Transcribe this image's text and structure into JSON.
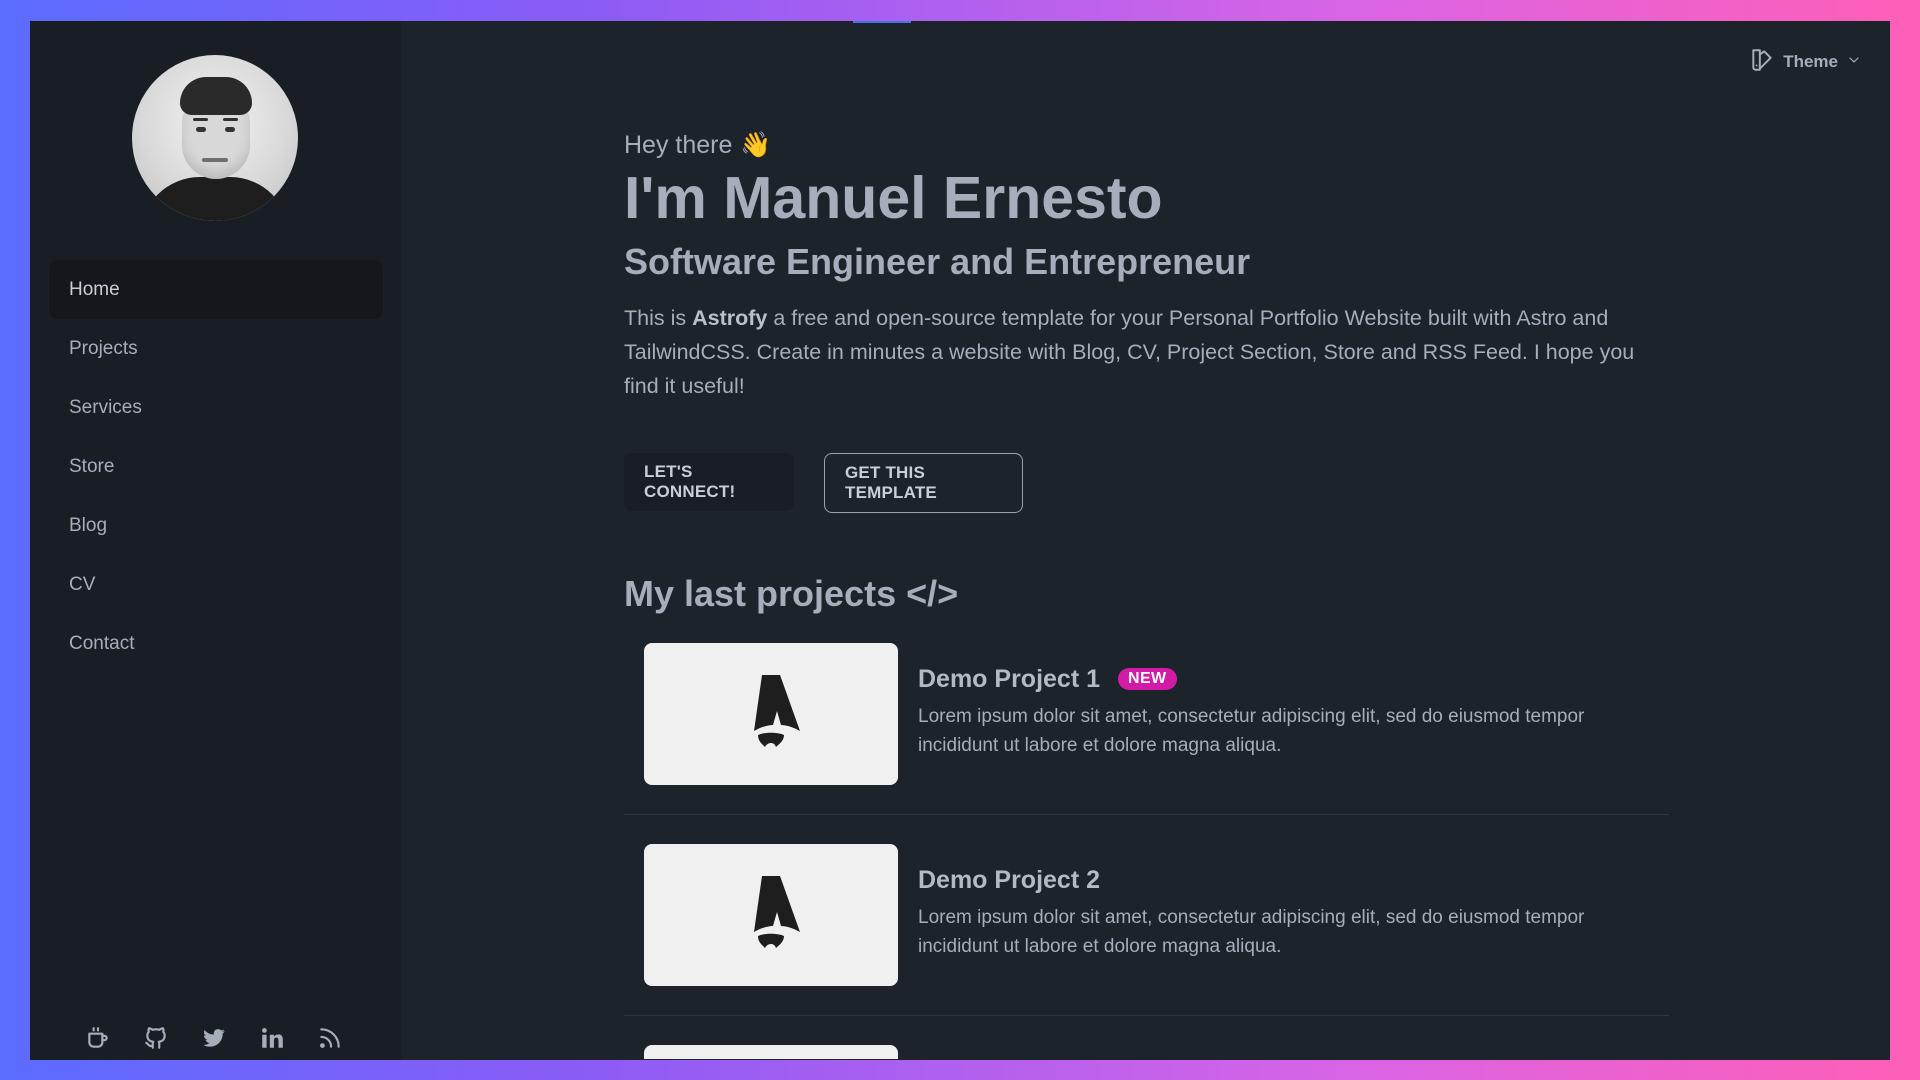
{
  "sidebar": {
    "nav": [
      {
        "label": "Home",
        "active": true
      },
      {
        "label": "Projects",
        "active": false
      },
      {
        "label": "Services",
        "active": false
      },
      {
        "label": "Store",
        "active": false
      },
      {
        "label": "Blog",
        "active": false
      },
      {
        "label": "CV",
        "active": false
      },
      {
        "label": "Contact",
        "active": false
      }
    ],
    "social_icons": [
      "coffee-cup-icon",
      "github-icon",
      "twitter-icon",
      "linkedin-icon",
      "rss-icon"
    ]
  },
  "header": {
    "theme_label": "Theme"
  },
  "hero": {
    "greeting": "Hey there",
    "greeting_emoji": "👋",
    "headline": "I'm Manuel Ernesto",
    "subheadline": "Software Engineer and Entrepreneur",
    "intro_before": "This is ",
    "intro_bold": "Astrofy",
    "intro_after": " a free and open-source template for your Personal Portfolio Website built with Astro and TailwindCSS. Create in minutes a website with Blog, CV, Project Section, Store and RSS Feed. I hope you find it useful!",
    "btn_connect": "LET'S CONNECT!",
    "btn_template": "GET THIS TEMPLATE"
  },
  "projects": {
    "title": "My last projects </>",
    "items": [
      {
        "title": "Demo Project 1",
        "badge": "NEW",
        "description": "Lorem ipsum dolor sit amet, consectetur adipiscing elit, sed do eiusmod tempor incididunt ut labore et dolore magna aliqua."
      },
      {
        "title": "Demo Project 2",
        "badge": "",
        "description": "Lorem ipsum dolor sit amet, consectetur adipiscing elit, sed do eiusmod tempor incididunt ut labore et dolore magna aliqua."
      }
    ]
  },
  "colors": {
    "background": "#1d232a",
    "sidebar": "#191e24",
    "text": "#a6adbb",
    "badge": "#d21ba6",
    "frame_gradient_start": "#5b6cff",
    "frame_gradient_end": "#ff5fb7"
  }
}
